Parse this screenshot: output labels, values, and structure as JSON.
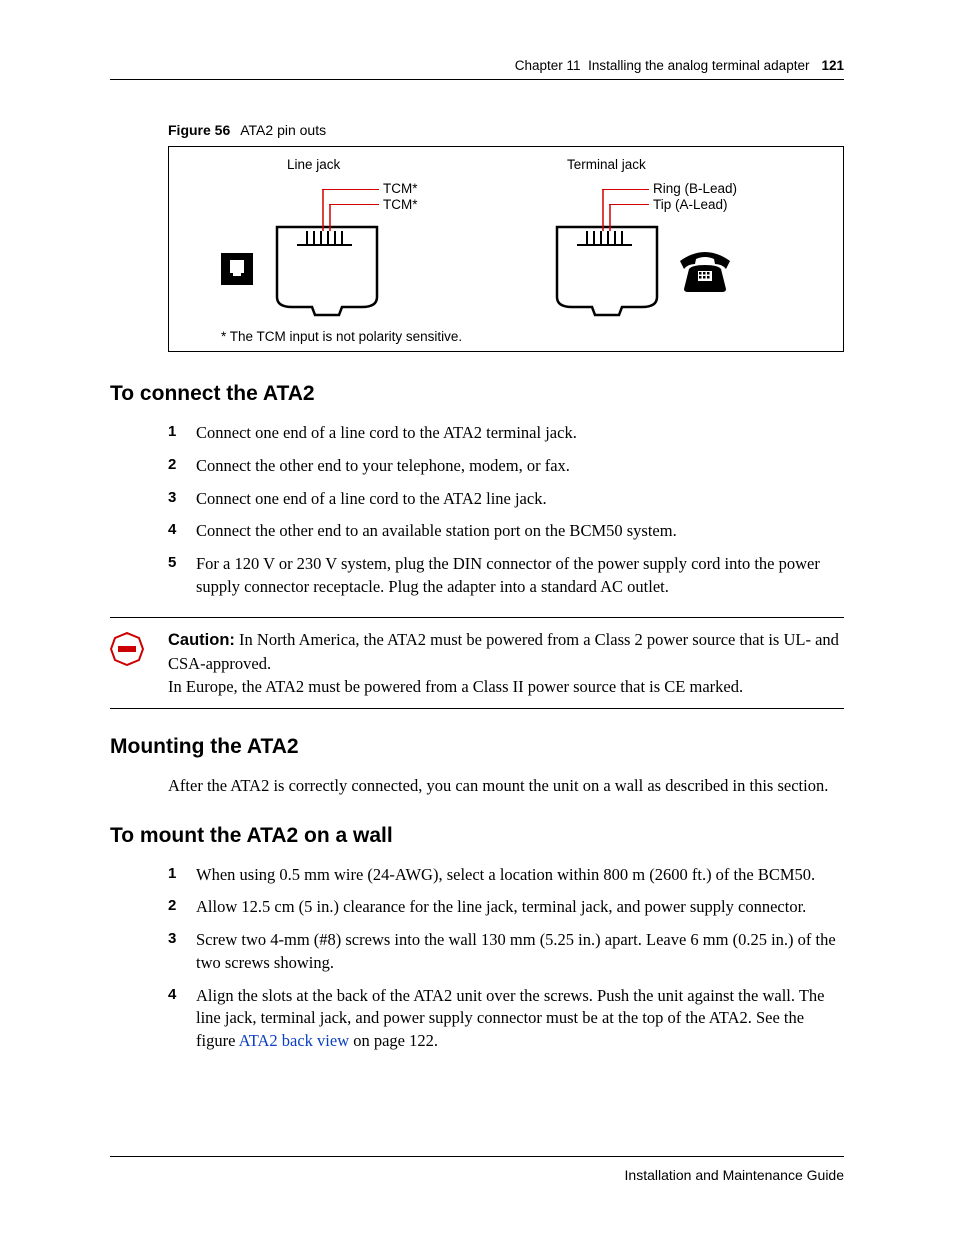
{
  "header": {
    "chapter": "Chapter 11",
    "title": "Installing the analog terminal adapter",
    "page": "121"
  },
  "figure": {
    "label": "Figure 56",
    "title": "ATA2 pin outs",
    "line_jack_title": "Line jack",
    "terminal_jack_title": "Terminal jack",
    "label_tcm1": "TCM*",
    "label_tcm2": "TCM*",
    "label_ring": "Ring (B-Lead)",
    "label_tip": "Tip (A-Lead)",
    "footnote": "* The TCM input is not polarity sensitive."
  },
  "sec_connect": {
    "heading": "To connect the ATA2",
    "steps": [
      "Connect one end of a line cord to the ATA2 terminal jack.",
      "Connect the other end to your telephone, modem, or fax.",
      "Connect one end of a line cord to the ATA2 line jack.",
      "Connect the other end to an available station port on the BCM50 system.",
      "For a 120 V or 230 V system, plug the DIN connector of the power supply cord into the power supply connector receptacle. Plug the adapter into a standard AC outlet."
    ]
  },
  "caution": {
    "lead": "Caution:",
    "line1": " In North America, the ATA2 must be powered from a Class 2 power source that is UL- and CSA-approved.",
    "line2": "In Europe, the ATA2 must be powered from a Class II power source that is CE marked."
  },
  "sec_mount": {
    "heading": "Mounting the ATA2",
    "intro": "After the ATA2 is correctly connected, you can mount the unit on a wall as described in this section."
  },
  "sec_wall": {
    "heading": "To mount the ATA2 on a wall",
    "steps": [
      {
        "text": "When using 0.5 mm wire (24-AWG), select a location within 800 m (2600 ft.) of the BCM50."
      },
      {
        "text": "Allow 12.5 cm (5 in.) clearance for the line jack, terminal jack, and power supply connector."
      },
      {
        "text": "Screw two 4-mm (#8) screws into the wall 130 mm (5.25 in.) apart. Leave 6 mm (0.25 in.) of the two screws showing."
      },
      {
        "text_pre": "Align the slots at the back of the ATA2 unit over the screws. Push the unit against the wall. The line jack, terminal jack, and power supply connector must be at the top of the ATA2. See the figure ",
        "link": "ATA2 back view",
        "text_post": " on page 122."
      }
    ]
  },
  "footer": "Installation and Maintenance Guide"
}
